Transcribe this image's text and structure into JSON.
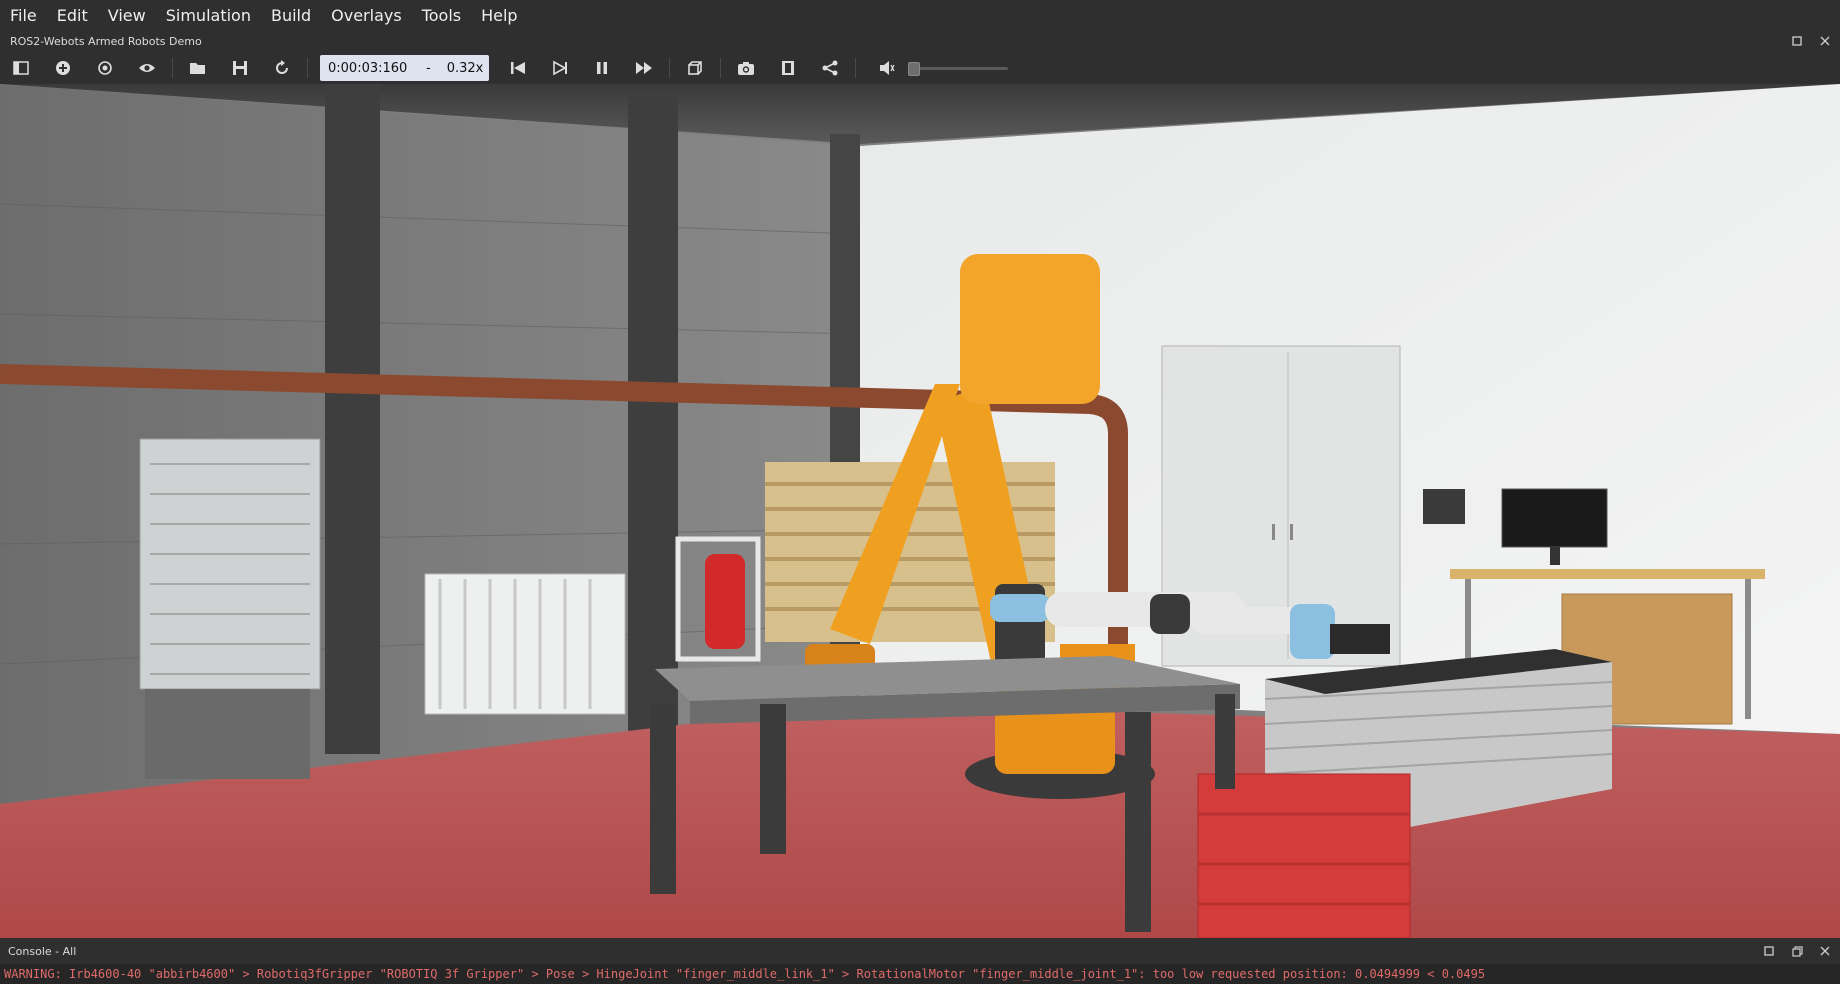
{
  "menu": {
    "items": [
      "File",
      "Edit",
      "View",
      "Simulation",
      "Build",
      "Overlays",
      "Tools",
      "Help"
    ]
  },
  "window": {
    "title": "ROS2-Webots Armed Robots Demo"
  },
  "toolbar": {
    "icons": [
      "toggle-scene-tree-icon",
      "add-node-icon",
      "reset-view-icon",
      "eye-icon",
      "open-folder-icon",
      "save-icon",
      "reload-icon",
      "step-back-icon",
      "step-icon",
      "pause-icon",
      "fast-forward-icon",
      "cube-view-icon",
      "camera-icon",
      "film-icon",
      "share-icon",
      "volume-mute-icon"
    ],
    "time": "0:00:03:160",
    "time_separator": "-",
    "speed": "0.32x",
    "volume_level": 0
  },
  "viewport": {
    "description_icon": "3d-scene"
  },
  "console": {
    "title": "Console - All",
    "message": "WARNING: Irb4600-40 \"abbirb4600\" > Robotiq3fGripper \"ROBOTIQ 3f Gripper\" > Pose  > HingeJoint \"finger_middle_link_1\" > RotationalMotor \"finger_middle_joint_1\": too low requested position: 0.0494999 < 0.0495"
  },
  "colors": {
    "chrome": "#2f2f2f",
    "time_box": "#dfe2ef",
    "warning_text": "#e06a6a",
    "robot_orange": "#f0a020",
    "floor": "#b85555"
  }
}
